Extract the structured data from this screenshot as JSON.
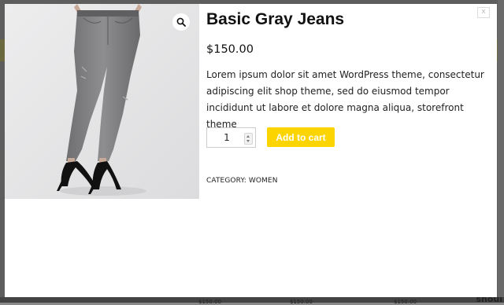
{
  "background": {
    "bottom_right_text": "shoul",
    "prices": [
      "$150.00",
      "$150.00",
      "$150.00"
    ]
  },
  "modal": {
    "close_label": "x",
    "product": {
      "title": "Basic Gray Jeans",
      "price": "$150.00",
      "description": "Lorem ipsum dolor sit amet WordPress theme, consectetur adipiscing elit shop theme, sed do eiusmod tempor incididunt ut labore et dolore magna aliqua, storefront theme",
      "quantity": "1",
      "add_to_cart_label": "Add to cart",
      "category_label": "CATEGORY:",
      "category_value": "WOMEN"
    },
    "icons": {
      "zoom": "magnifier-icon",
      "close": "close-icon"
    }
  },
  "colors": {
    "accent": "#fcd400",
    "overlay": "#5e5e5e",
    "modal_bg": "#ffffff",
    "image_bg": "#e7e7e8"
  }
}
